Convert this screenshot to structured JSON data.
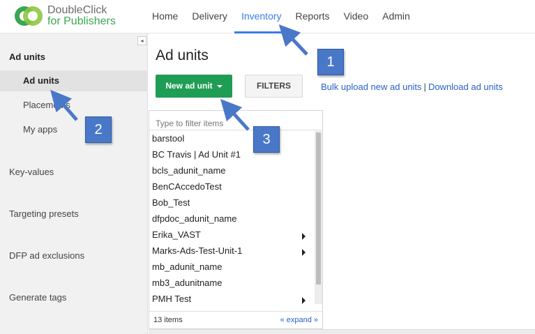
{
  "header": {
    "brand_line1": "DoubleClick",
    "brand_line2": "for Publishers",
    "nav": [
      "Home",
      "Delivery",
      "Inventory",
      "Reports",
      "Video",
      "Admin"
    ],
    "active_nav": "Inventory"
  },
  "sidebar": {
    "collapse_glyph": "◂",
    "section_title": "Ad units",
    "sub_items": [
      "Ad units",
      "Placements",
      "My apps"
    ],
    "sections": [
      "Key-values",
      "Targeting presets",
      "DFP ad exclusions",
      "Generate tags"
    ]
  },
  "main": {
    "title": "Ad units",
    "new_button": "New ad unit",
    "filters_button": "FILTERS",
    "bulk_upload_link": "Bulk upload new ad units",
    "separator": "|",
    "download_link": "Download ad units"
  },
  "list": {
    "filter_placeholder": "Type to filter items",
    "items": [
      {
        "name": "barstool",
        "has_children": false
      },
      {
        "name": "BC Travis | Ad Unit #1",
        "has_children": false
      },
      {
        "name": "bcls_adunit_name",
        "has_children": false
      },
      {
        "name": "BenCAccedoTest",
        "has_children": false
      },
      {
        "name": "Bob_Test",
        "has_children": false
      },
      {
        "name": "dfpdoc_adunit_name",
        "has_children": false
      },
      {
        "name": "Erika_VAST",
        "has_children": true
      },
      {
        "name": "Marks-Ads-Test-Unit-1",
        "has_children": true
      },
      {
        "name": "mb_adunit_name",
        "has_children": false
      },
      {
        "name": "mb3_adunitname",
        "has_children": false
      },
      {
        "name": "PMH Test",
        "has_children": true
      }
    ],
    "count_label": "13 items",
    "expand_link": "« expand »"
  },
  "callouts": [
    "1",
    "2",
    "3"
  ],
  "colors": {
    "accent_blue": "#3b7be8",
    "button_green": "#1f9d55",
    "callout_blue": "#4a78c9",
    "brand_green": "#3aa655"
  }
}
